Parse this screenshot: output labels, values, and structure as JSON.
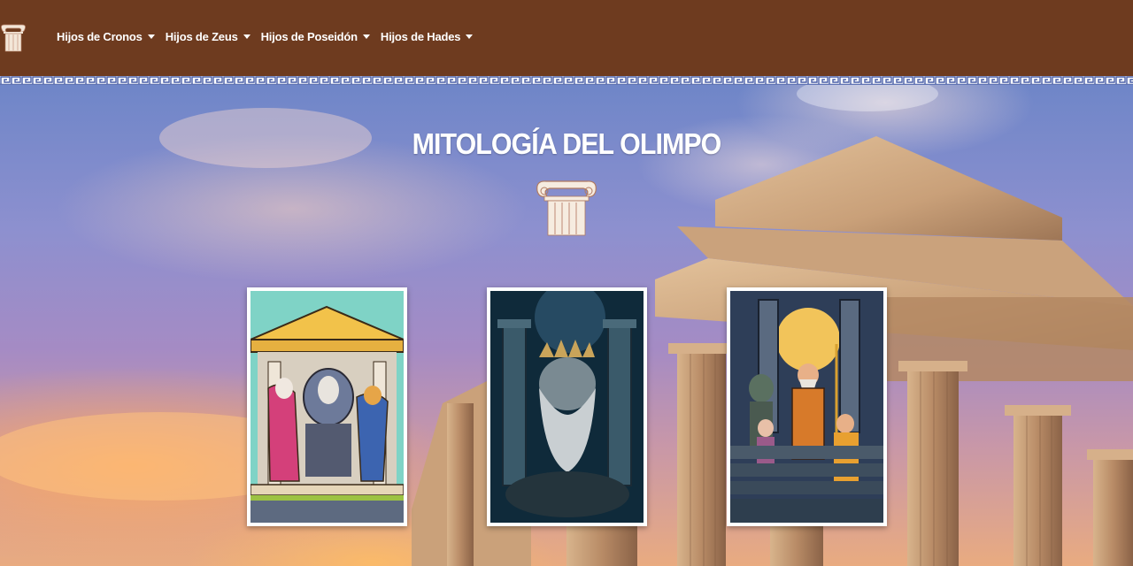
{
  "header": {
    "logo_icon": "ionic-column-icon",
    "nav": [
      {
        "label": "Hijos de Cronos"
      },
      {
        "label": "Hijos de Zeus"
      },
      {
        "label": "Hijos de Poseidón"
      },
      {
        "label": "Hijos de Hades"
      }
    ]
  },
  "hero": {
    "title": "MITOLOGÍA DEL OLIMPO",
    "icon": "ionic-column-icon",
    "cards": [
      {
        "name": "gods-temple-illustration"
      },
      {
        "name": "bearded-god-illustration"
      },
      {
        "name": "underworld-gods-illustration"
      }
    ]
  },
  "colors": {
    "header_bg": "#6e3b1f",
    "meander": "#4a5fa8",
    "title": "#ffffff"
  }
}
